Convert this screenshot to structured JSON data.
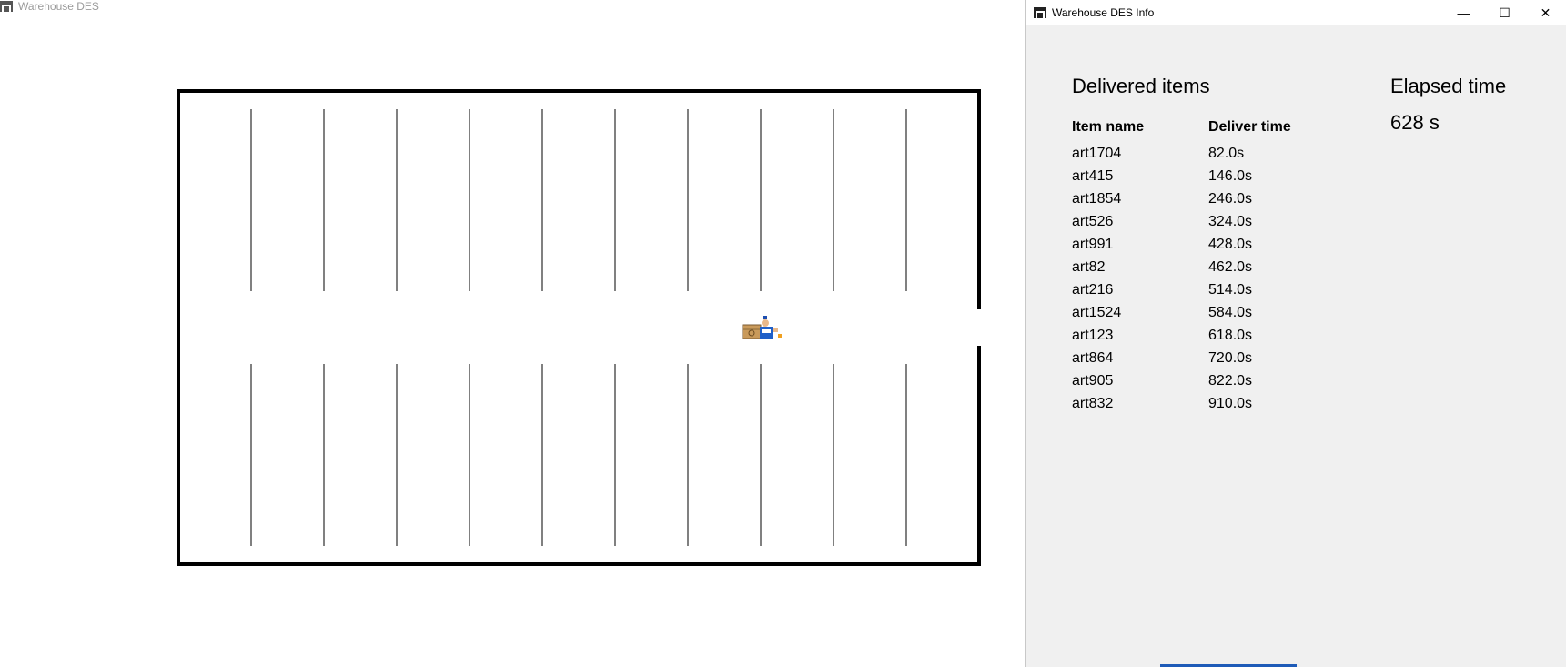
{
  "main_window": {
    "title": "Warehouse DES",
    "icon": "warehouse-icon",
    "worker_icon": "worker-with-box-icon"
  },
  "info_window": {
    "title": "Warehouse DES Info",
    "icon": "warehouse-icon",
    "controls": {
      "minimize": "—",
      "maximize": "☐",
      "close": "✕"
    },
    "delivered_heading": "Delivered items",
    "elapsed_heading": "Elapsed time",
    "elapsed_value": "628 s",
    "columns": {
      "item_name": "Item name",
      "deliver_time": "Deliver time"
    },
    "items": [
      {
        "name": "art1704",
        "time": "82.0s"
      },
      {
        "name": "art415",
        "time": "146.0s"
      },
      {
        "name": "art1854",
        "time": "246.0s"
      },
      {
        "name": "art526",
        "time": "324.0s"
      },
      {
        "name": "art991",
        "time": "428.0s"
      },
      {
        "name": "art82",
        "time": "462.0s"
      },
      {
        "name": "art216",
        "time": "514.0s"
      },
      {
        "name": "art1524",
        "time": "584.0s"
      },
      {
        "name": "art123",
        "time": "618.0s"
      },
      {
        "name": "art864",
        "time": "720.0s"
      },
      {
        "name": "art905",
        "time": "822.0s"
      },
      {
        "name": "art832",
        "time": "910.0s"
      }
    ]
  }
}
